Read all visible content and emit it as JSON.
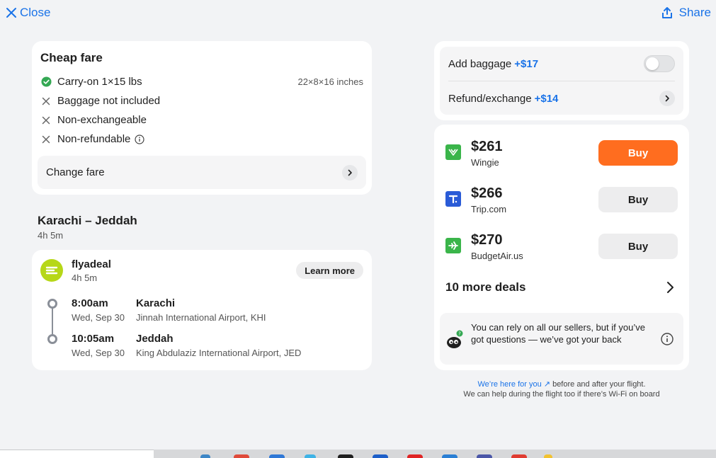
{
  "header": {
    "close_label": "Close",
    "share_label": "Share"
  },
  "fare": {
    "title": "Cheap fare",
    "items": [
      {
        "label": "Carry-on 1×15 lbs",
        "detail": "22×8×16 inches",
        "icon": "check-circle-icon",
        "color": "#34a853"
      },
      {
        "label": "Baggage not included",
        "icon": "x-icon"
      },
      {
        "label": "Non-exchangeable",
        "icon": "x-icon"
      },
      {
        "label": "Non-refundable",
        "icon": "x-icon"
      }
    ],
    "change_fare_label": "Change fare"
  },
  "route": {
    "title": "Karachi – Jeddah",
    "duration": "4h 5m"
  },
  "flight": {
    "airline": "flyadeal",
    "duration": "4h 5m",
    "learn_more_label": "Learn more",
    "segments": [
      {
        "time": "8:00am",
        "date": "Wed, Sep 30",
        "city": "Karachi",
        "airport": "Jinnah International Airport, KHI"
      },
      {
        "time": "10:05am",
        "date": "Wed, Sep 30",
        "city": "Jeddah",
        "airport": "King Abdulaziz International Airport, JED"
      }
    ]
  },
  "options": {
    "baggage_label": "Add baggage",
    "baggage_price": "+$17",
    "refund_label": "Refund/exchange",
    "refund_price": "+$14"
  },
  "deals": {
    "items": [
      {
        "price": "$261",
        "seller": "Wingie",
        "buy_label": "Buy",
        "logo_color": "#3ab54a"
      },
      {
        "price": "$266",
        "seller": "Trip.com",
        "buy_label": "Buy",
        "logo_color": "#2a5bd7"
      },
      {
        "price": "$270",
        "seller": "BudgetAir.us",
        "buy_label": "Buy",
        "logo_color": "#3ab54a"
      }
    ],
    "more_label": "10 more deals",
    "rely_text": "You can rely on all our sellers, but if you’ve got questions — we’ve got your back"
  },
  "footer": {
    "link_text": "We’re here for you ↗",
    "line1_rest": " before and after your flight.",
    "line2": "We can help during the flight too if there’s Wi-Fi on board"
  },
  "colors": {
    "accent": "#1a73e8",
    "buy_primary": "#ff6d1f"
  }
}
